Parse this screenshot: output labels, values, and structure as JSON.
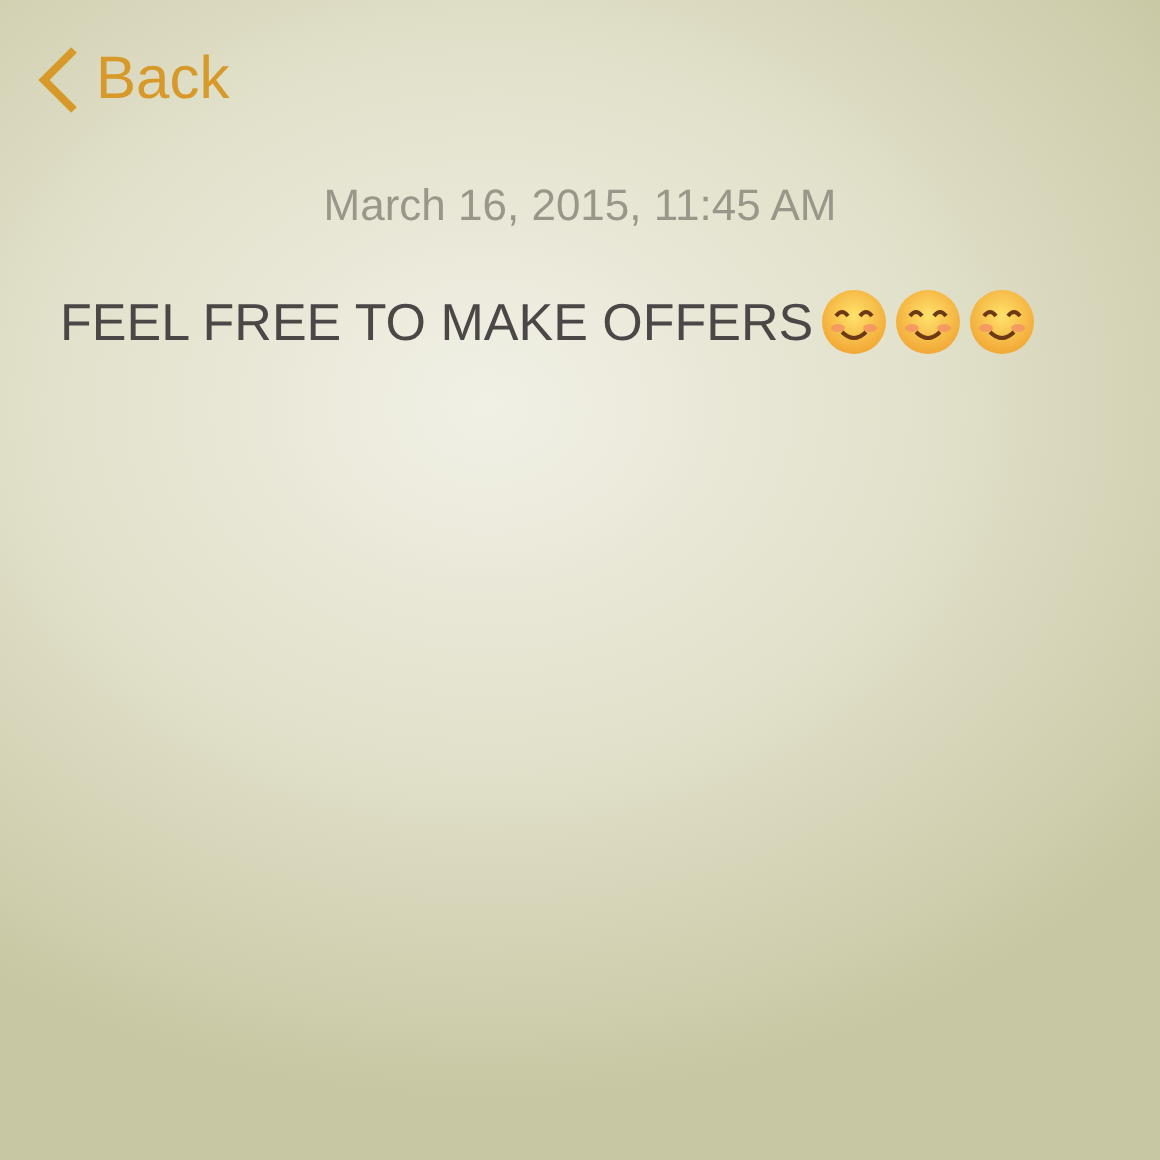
{
  "nav": {
    "back_label": "Back"
  },
  "note": {
    "date": "March 16, 2015, 11:45 AM",
    "text": "FEEL FREE TO MAKE OFFERS",
    "emojis": [
      {
        "kind": "smile"
      },
      {
        "kind": "smile"
      },
      {
        "kind": "smile"
      }
    ]
  }
}
